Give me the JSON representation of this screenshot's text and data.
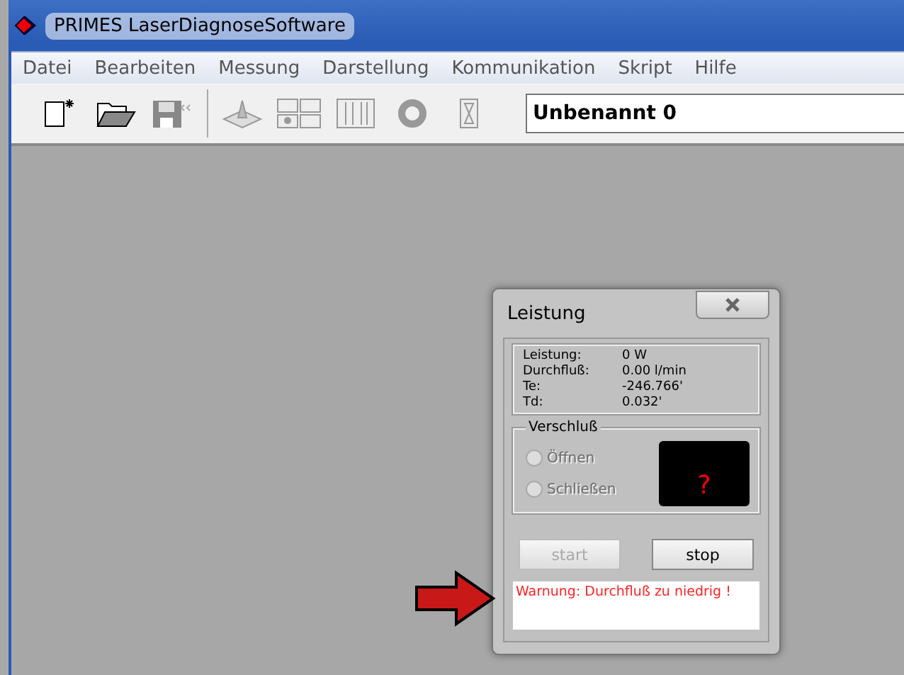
{
  "window": {
    "title": "PRIMES LaserDiagnoseSoftware"
  },
  "menu": [
    "Datei",
    "Bearbeiten",
    "Messung",
    "Darstellung",
    "Kommunikation",
    "Skript",
    "Hilfe"
  ],
  "toolbar": {
    "document_name": "Unbenannt 0"
  },
  "dialog": {
    "title": "Leistung",
    "readings": [
      {
        "label": "Leistung:",
        "value": "0 W"
      },
      {
        "label": "Durchfluß:",
        "value": "0.00 l/min"
      },
      {
        "label": "Te:",
        "value": "-246.766'"
      },
      {
        "label": "Td:",
        "value": "0.032'"
      }
    ],
    "shutter": {
      "title": "Verschluß",
      "options": [
        {
          "label": "Öffnen",
          "selected": false,
          "disabled": true
        },
        {
          "label": "Schließen",
          "selected": false,
          "disabled": true
        }
      ],
      "status": "?"
    },
    "buttons": [
      {
        "label": "start",
        "disabled": true
      },
      {
        "label": "stop",
        "disabled": false
      }
    ],
    "message": "Warnung: Durchfluß zu niedrig !"
  }
}
